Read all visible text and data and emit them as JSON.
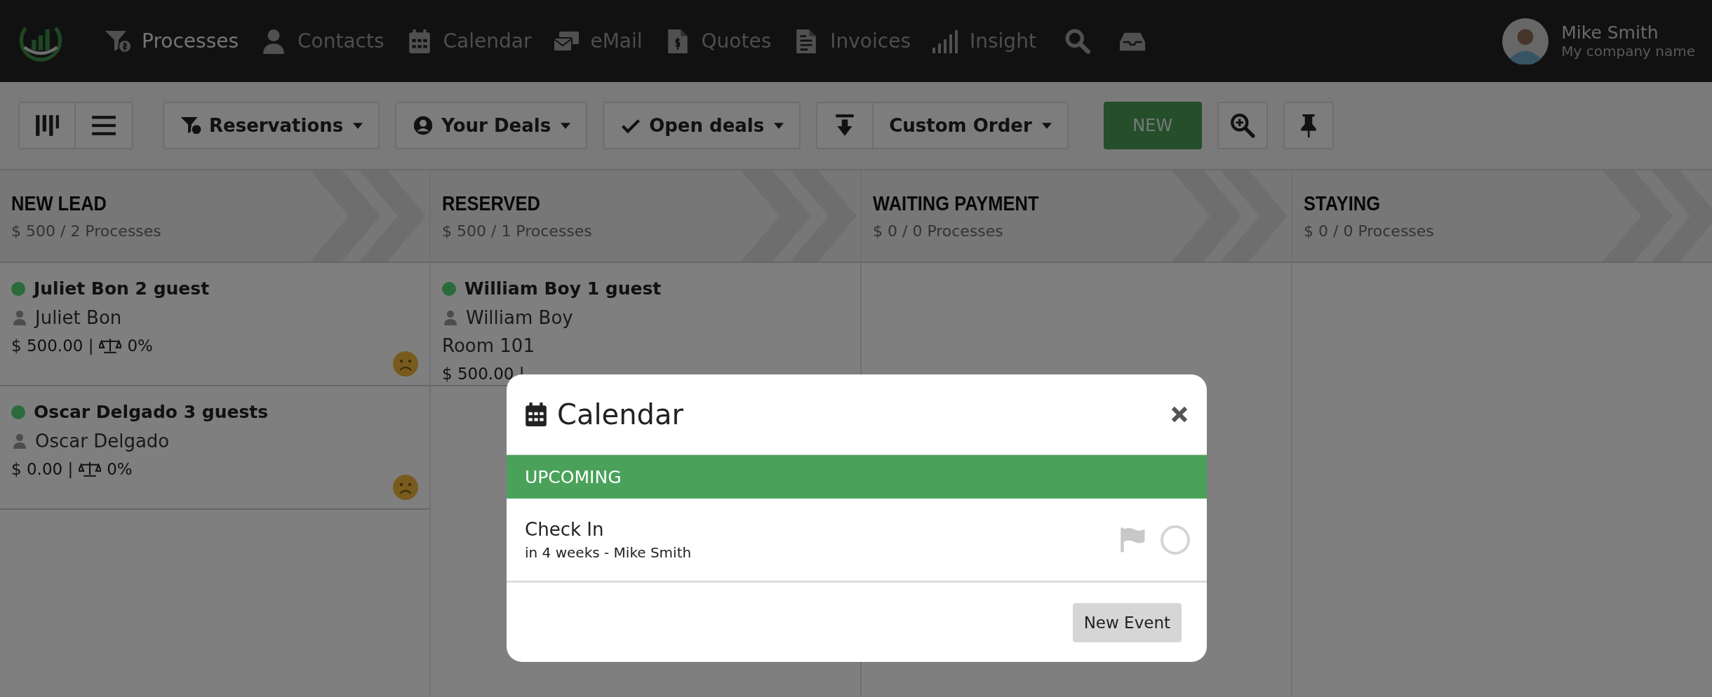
{
  "nav": {
    "items": [
      {
        "kind": "funnel",
        "label": "Processes",
        "selected": true
      },
      {
        "kind": "person",
        "label": "Contacts",
        "selected": false
      },
      {
        "kind": "calendar",
        "label": "Calendar",
        "selected": false
      },
      {
        "kind": "mail",
        "label": "eMail",
        "selected": false
      },
      {
        "kind": "quote",
        "label": "Quotes",
        "selected": false
      },
      {
        "kind": "invoice",
        "label": "Invoices",
        "selected": false
      },
      {
        "kind": "bars",
        "label": "Insight",
        "selected": false
      }
    ],
    "user": {
      "name": "Mike Smith",
      "company": "My company name"
    }
  },
  "toolbar": {
    "filters": [
      {
        "kind": "funnel",
        "label": "Reservations"
      },
      {
        "kind": "user",
        "label": "Your Deals"
      },
      {
        "kind": "check",
        "label": "Open deals"
      }
    ],
    "sort": {
      "label": "Custom Order"
    },
    "new_button": "NEW"
  },
  "columns": [
    {
      "title": "NEW LEAD",
      "summary": "$ 500 / 2 Processes",
      "cards": [
        {
          "title": "Juliet Bon 2 guest",
          "contact": "Juliet Bon",
          "amount": "$ 500.00 |",
          "probability": "0%",
          "color": "#2b6b3a",
          "unhappy": true
        },
        {
          "title": "Oscar Delgado 3 guests",
          "contact": "Oscar Delgado",
          "amount": "$ 0.00 |",
          "probability": "0%",
          "color": "#2b6b3a",
          "unhappy": true
        }
      ]
    },
    {
      "title": "RESERVED",
      "summary": "$ 500 / 1 Processes",
      "cards": [
        {
          "title": "William Boy 1 guest",
          "contact": "William Boy",
          "note": "Room 101",
          "amount": "$ 500.00 |",
          "color": "#2b6b3a"
        }
      ]
    },
    {
      "title": "WAITING PAYMENT",
      "summary": "$ 0 / 0 Processes"
    },
    {
      "title": "STAYING",
      "summary": "$ 0 / 0 Processes"
    }
  ],
  "modal": {
    "title": "Calendar",
    "section": "UPCOMING",
    "events": [
      {
        "title": "Check In",
        "meta": "in 4 weeks - Mike Smith",
        "done": false
      }
    ],
    "button": "New Event"
  }
}
